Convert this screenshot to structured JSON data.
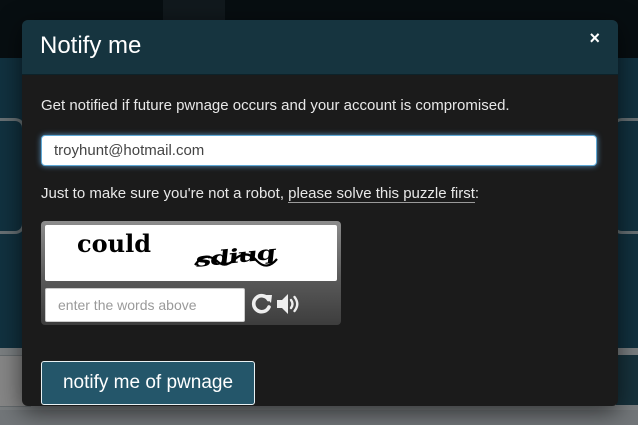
{
  "modal": {
    "title": "Notify me",
    "close_glyph": "×",
    "intro": "Get notified if future pwnage occurs and your account is compromised.",
    "email_value": "troyhunt@hotmail.com",
    "robot_prefix": "Just to make sure you're not a robot, ",
    "robot_link": "please solve this puzzle first",
    "robot_suffix": ":",
    "captcha": {
      "word_1": "could",
      "word_2": "sdiuq",
      "input_placeholder": "enter the words above",
      "refresh_icon": "refresh-icon",
      "audio_icon": "audio-icon"
    },
    "submit_label": "notify me of pwnage"
  },
  "colors": {
    "modal_header": "#16343f",
    "modal_body": "#1b1b1b",
    "button": "#24566a",
    "hero": "#1f5a73"
  }
}
